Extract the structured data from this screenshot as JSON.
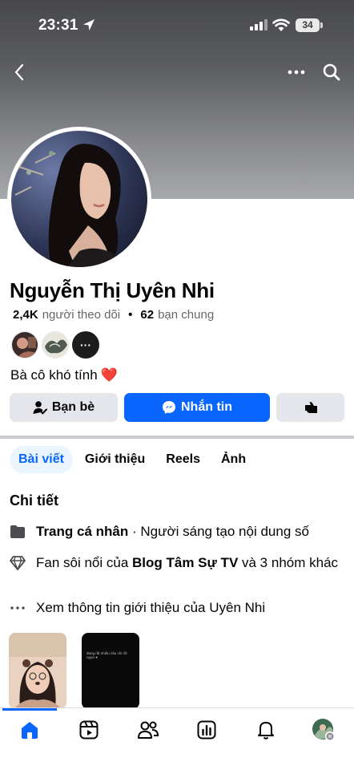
{
  "status_bar": {
    "time": "23:31",
    "battery": "34",
    "icons": [
      "location-arrow-icon",
      "signal-icon",
      "wifi-icon",
      "battery-icon"
    ]
  },
  "top_nav": {
    "icons": [
      "back-chevron-icon",
      "more-dots-icon",
      "search-icon"
    ]
  },
  "profile": {
    "name": "Nguyễn Thị Uyên Nhi",
    "followers_count": "2,4K",
    "followers_label": "người theo dõi",
    "separator": "•",
    "mutual_count": "62",
    "mutual_label": "bạn chung",
    "mutual_more": "···",
    "bio": "Bà cô khó tính",
    "bio_emoji": "❤️"
  },
  "actions": {
    "friends_label": "Bạn bè",
    "message_label": "Nhắn tin",
    "icons": [
      "friend-check-icon",
      "messenger-icon",
      "thumbs-gesture-icon"
    ]
  },
  "tabs": [
    {
      "label": "Bài viết",
      "active": true
    },
    {
      "label": "Giới thiệu",
      "active": false
    },
    {
      "label": "Reels",
      "active": false
    },
    {
      "label": "Ảnh",
      "active": false
    }
  ],
  "details": {
    "title": "Chi tiết",
    "page_bold": "Trang cá nhân",
    "page_rest": " · Người sáng tạo nội dung số",
    "fan_prefix": "Fan sôi nổi của ",
    "fan_bold": "Blog Tâm Sự TV",
    "fan_suffix": " và 3 nhóm khác",
    "see_about": "Xem thông tin giới thiệu của Uyên Nhi"
  },
  "thumbnails": {
    "second_caption": "đang rất nhiều câu chi rồi ngọn ●"
  },
  "bottom_nav": {
    "items": [
      "home-icon",
      "video-icon",
      "friends-icon",
      "dashboard-icon",
      "notifications-icon",
      "profile-avatar"
    ]
  },
  "colors": {
    "accent": "#0866ff",
    "tab_active_bg": "#ebf5ff",
    "button_gray": "#e4e6eb",
    "heart": "#e0245e"
  }
}
